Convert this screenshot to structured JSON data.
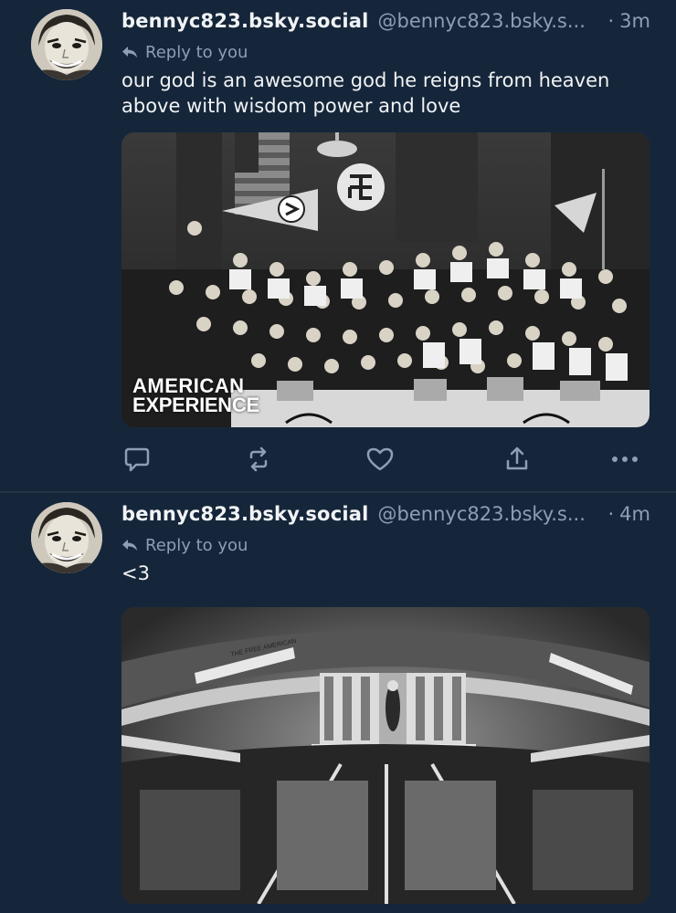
{
  "colors": {
    "background": "#15263a",
    "divider": "#233447",
    "text_primary": "#f1f3f5",
    "text_secondary": "#8d9fb3"
  },
  "posts": [
    {
      "display_name": "bennyc823.bsky.social",
      "handle": "@bennyc823.bsky.s...",
      "separator": "·",
      "time": "3m",
      "reply_label": "Reply to you",
      "text": "our god is an awesome god he reigns from heaven above with wisdom power and love",
      "image": {
        "watermark_line1": "AMERICAN",
        "watermark_line2": "EXPERIENCE"
      },
      "actions": [
        "comment-icon",
        "repost-icon",
        "heart-icon",
        "share-icon",
        "more-icon"
      ]
    },
    {
      "display_name": "bennyc823.bsky.social",
      "handle": "@bennyc823.bsky.s...",
      "separator": "·",
      "time": "4m",
      "reply_label": "Reply to you",
      "text": "<3",
      "image": {
        "banner_text": "THE FREE AMERICAN"
      }
    }
  ]
}
